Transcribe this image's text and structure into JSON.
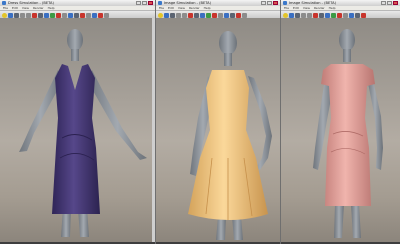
{
  "windows": [
    {
      "title": "Dress Simulation - (BETA)",
      "menu": [
        "File",
        "Edit",
        "View",
        "Render",
        "Help"
      ],
      "viewport": {
        "garment": "sleeveless v-neck sheath dress",
        "color": "#4a3b78"
      }
    },
    {
      "title": "Image Simulation - (BETA)",
      "menu": [
        "File",
        "Edit",
        "View",
        "Render",
        "Help"
      ],
      "viewport": {
        "garment": "sleeveless fit and flare dress",
        "color": "#f2c987"
      }
    },
    {
      "title": "Image Simulation - (BETA)",
      "menu": [
        "File",
        "Edit",
        "View",
        "Render",
        "Help"
      ],
      "viewport": {
        "garment": "cap sleeve sheath dress",
        "color": "#e4a39d"
      }
    }
  ],
  "colors": {
    "mannequin": "#8e949b",
    "background_top": "#8f8b85",
    "background_bottom": "#8c857c",
    "window_chrome": "#d4d0c8"
  },
  "toolbar_icons": [
    "new-icon",
    "open-icon",
    "save-icon",
    "undo-icon",
    "redo-icon",
    "move-icon",
    "rotate-icon",
    "scale-icon",
    "simulate-icon",
    "render-icon"
  ]
}
